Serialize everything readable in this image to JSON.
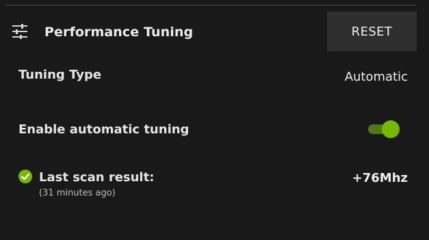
{
  "header": {
    "icon": "sliders-icon",
    "title": "Performance Tuning",
    "reset_label": "RESET"
  },
  "tuning_type": {
    "label": "Tuning Type",
    "value": "Automatic"
  },
  "automatic_tuning": {
    "label": "Enable automatic tuning",
    "enabled": true
  },
  "last_scan": {
    "icon": "check-circle-icon",
    "label": "Last scan result:",
    "time": "(31 minutes ago)",
    "value": "+76Mhz"
  },
  "colors": {
    "background": "#1a1919",
    "accent": "#76b900",
    "button_bg": "#2e2e2e"
  }
}
